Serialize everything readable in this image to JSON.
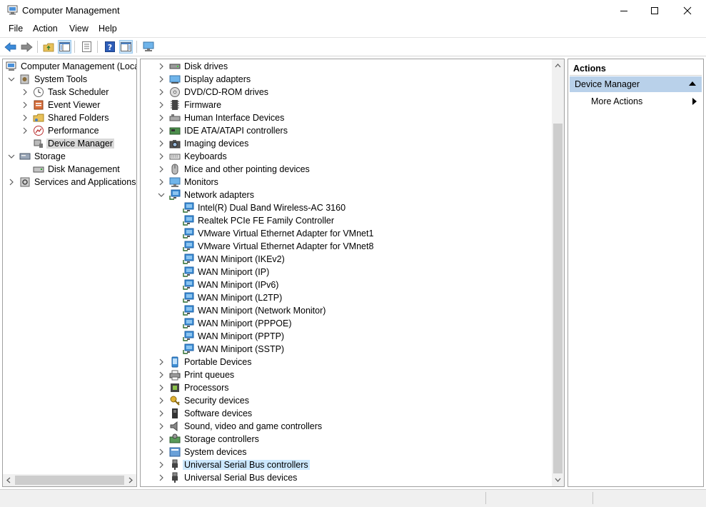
{
  "window": {
    "title": "Computer Management",
    "controls": [
      "minimize",
      "maximize",
      "close"
    ]
  },
  "menu": [
    "File",
    "Action",
    "View",
    "Help"
  ],
  "toolbar": {
    "buttons": [
      "back-icon",
      "forward-icon",
      "up-folder-icon",
      "show-hide-tree-icon",
      "properties-icon",
      "help-icon",
      "show-hide-action-pane-icon",
      "monitor-icon"
    ]
  },
  "left_tree": [
    {
      "label": "Computer Management (Local",
      "level": 0,
      "expander": "none",
      "icon": "computer-management-icon"
    },
    {
      "label": "System Tools",
      "level": 1,
      "expander": "expanded",
      "icon": "system-tools-icon"
    },
    {
      "label": "Task Scheduler",
      "level": 2,
      "expander": "collapsed",
      "icon": "clock-icon"
    },
    {
      "label": "Event Viewer",
      "level": 2,
      "expander": "collapsed",
      "icon": "event-viewer-icon"
    },
    {
      "label": "Shared Folders",
      "level": 2,
      "expander": "collapsed",
      "icon": "shared-folders-icon"
    },
    {
      "label": "Performance",
      "level": 2,
      "expander": "collapsed",
      "icon": "performance-icon"
    },
    {
      "label": "Device Manager",
      "level": 2,
      "expander": "none",
      "icon": "device-manager-icon",
      "selected": true
    },
    {
      "label": "Storage",
      "level": 1,
      "expander": "expanded",
      "icon": "storage-icon"
    },
    {
      "label": "Disk Management",
      "level": 2,
      "expander": "none",
      "icon": "disk-management-icon"
    },
    {
      "label": "Services and Applications",
      "level": 1,
      "expander": "collapsed",
      "icon": "services-icon"
    }
  ],
  "device_tree": [
    {
      "label": "Disk drives",
      "level": 0,
      "expander": "collapsed",
      "icon": "disk-drive-icon"
    },
    {
      "label": "Display adapters",
      "level": 0,
      "expander": "collapsed",
      "icon": "display-adapter-icon"
    },
    {
      "label": "DVD/CD-ROM drives",
      "level": 0,
      "expander": "collapsed",
      "icon": "dvd-drive-icon"
    },
    {
      "label": "Firmware",
      "level": 0,
      "expander": "collapsed",
      "icon": "firmware-icon"
    },
    {
      "label": "Human Interface Devices",
      "level": 0,
      "expander": "collapsed",
      "icon": "hid-icon"
    },
    {
      "label": "IDE ATA/ATAPI controllers",
      "level": 0,
      "expander": "collapsed",
      "icon": "ide-controller-icon"
    },
    {
      "label": "Imaging devices",
      "level": 0,
      "expander": "collapsed",
      "icon": "camera-icon"
    },
    {
      "label": "Keyboards",
      "level": 0,
      "expander": "collapsed",
      "icon": "keyboard-icon"
    },
    {
      "label": "Mice and other pointing devices",
      "level": 0,
      "expander": "collapsed",
      "icon": "mouse-icon"
    },
    {
      "label": "Monitors",
      "level": 0,
      "expander": "collapsed",
      "icon": "monitor-icon"
    },
    {
      "label": "Network adapters",
      "level": 0,
      "expander": "expanded",
      "icon": "network-adapter-icon"
    },
    {
      "label": "Intel(R) Dual Band Wireless-AC 3160",
      "level": 1,
      "expander": "none",
      "icon": "network-adapter-icon"
    },
    {
      "label": "Realtek PCIe FE Family Controller",
      "level": 1,
      "expander": "none",
      "icon": "network-adapter-icon"
    },
    {
      "label": "VMware Virtual Ethernet Adapter for VMnet1",
      "level": 1,
      "expander": "none",
      "icon": "network-adapter-icon"
    },
    {
      "label": "VMware Virtual Ethernet Adapter for VMnet8",
      "level": 1,
      "expander": "none",
      "icon": "network-adapter-icon"
    },
    {
      "label": "WAN Miniport (IKEv2)",
      "level": 1,
      "expander": "none",
      "icon": "network-adapter-icon"
    },
    {
      "label": "WAN Miniport (IP)",
      "level": 1,
      "expander": "none",
      "icon": "network-adapter-icon"
    },
    {
      "label": "WAN Miniport (IPv6)",
      "level": 1,
      "expander": "none",
      "icon": "network-adapter-icon"
    },
    {
      "label": "WAN Miniport (L2TP)",
      "level": 1,
      "expander": "none",
      "icon": "network-adapter-icon"
    },
    {
      "label": "WAN Miniport (Network Monitor)",
      "level": 1,
      "expander": "none",
      "icon": "network-adapter-icon"
    },
    {
      "label": "WAN Miniport (PPPOE)",
      "level": 1,
      "expander": "none",
      "icon": "network-adapter-icon"
    },
    {
      "label": "WAN Miniport (PPTP)",
      "level": 1,
      "expander": "none",
      "icon": "network-adapter-icon"
    },
    {
      "label": "WAN Miniport (SSTP)",
      "level": 1,
      "expander": "none",
      "icon": "network-adapter-icon"
    },
    {
      "label": "Portable Devices",
      "level": 0,
      "expander": "collapsed",
      "icon": "portable-device-icon"
    },
    {
      "label": "Print queues",
      "level": 0,
      "expander": "collapsed",
      "icon": "printer-icon"
    },
    {
      "label": "Processors",
      "level": 0,
      "expander": "collapsed",
      "icon": "processor-icon"
    },
    {
      "label": "Security devices",
      "level": 0,
      "expander": "collapsed",
      "icon": "security-device-icon"
    },
    {
      "label": "Software devices",
      "level": 0,
      "expander": "collapsed",
      "icon": "software-device-icon"
    },
    {
      "label": "Sound, video and game controllers",
      "level": 0,
      "expander": "collapsed",
      "icon": "speaker-icon"
    },
    {
      "label": "Storage controllers",
      "level": 0,
      "expander": "collapsed",
      "icon": "storage-controller-icon"
    },
    {
      "label": "System devices",
      "level": 0,
      "expander": "collapsed",
      "icon": "system-device-icon"
    },
    {
      "label": "Universal Serial Bus controllers",
      "level": 0,
      "expander": "collapsed",
      "icon": "usb-icon",
      "selected": true
    },
    {
      "label": "Universal Serial Bus devices",
      "level": 0,
      "expander": "collapsed",
      "icon": "usb-icon"
    }
  ],
  "actions": {
    "header": "Actions",
    "section": "Device Manager",
    "items": [
      "More Actions"
    ]
  },
  "colors": {
    "selection_blue": "#cce8ff",
    "selection_gray": "#d9d9d9",
    "actions_section": "#b9d1ea",
    "network_icon": "#3d8fd6"
  }
}
